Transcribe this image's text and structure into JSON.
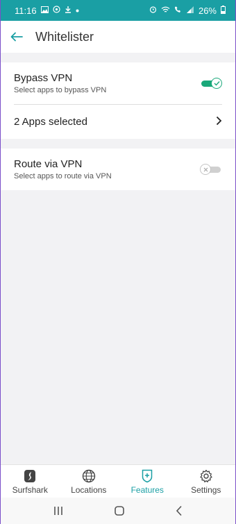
{
  "status_bar": {
    "time": "11:16",
    "battery": "26%",
    "left_icons": [
      "image-icon",
      "whatsapp-icon",
      "download-icon",
      "dot-icon"
    ],
    "right_icons": [
      "alarm-icon",
      "wifi-icon",
      "wifi-call-icon",
      "signal-icon",
      "battery-icon"
    ]
  },
  "app_bar": {
    "title": "Whitelister"
  },
  "bypass": {
    "title": "Bypass VPN",
    "subtitle": "Select apps to bypass VPN",
    "enabled": true,
    "selected_label": "2 Apps selected"
  },
  "route": {
    "title": "Route via VPN",
    "subtitle": "Select apps to route via VPN",
    "enabled": false
  },
  "tabs": [
    {
      "label": "Surfshark",
      "icon": "surfshark-logo-icon",
      "active": false
    },
    {
      "label": "Locations",
      "icon": "globe-icon",
      "active": false
    },
    {
      "label": "Features",
      "icon": "shield-plus-icon",
      "active": true
    },
    {
      "label": "Settings",
      "icon": "gear-icon",
      "active": false
    }
  ],
  "colors": {
    "accent": "#1a9fa4",
    "toggle_on": "#1aa87a",
    "background": "#f2f2f4"
  }
}
